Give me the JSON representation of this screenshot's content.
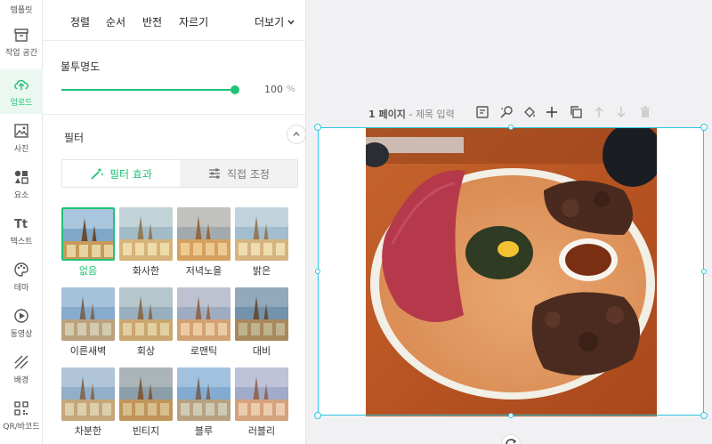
{
  "rail": {
    "template_label": "템플릿",
    "items": [
      {
        "label": "작업 공간",
        "icon": "archive-icon"
      },
      {
        "label": "업로드",
        "icon": "cloud-upload-icon",
        "active": true
      },
      {
        "label": "사진",
        "icon": "image-icon"
      },
      {
        "label": "요소",
        "icon": "shapes-icon"
      },
      {
        "label": "텍스트",
        "icon": "text-icon"
      },
      {
        "label": "테마",
        "icon": "palette-icon"
      },
      {
        "label": "동영상",
        "icon": "play-icon"
      },
      {
        "label": "배경",
        "icon": "stripes-icon"
      },
      {
        "label": "QR/바코드",
        "icon": "qr-icon"
      }
    ]
  },
  "toolbar": {
    "align": "정렬",
    "order": "순서",
    "flip": "반전",
    "crop": "자르기",
    "more": "더보기"
  },
  "opacity": {
    "label": "불투명도",
    "value": "100",
    "unit": "%",
    "level": 1.0
  },
  "filters": {
    "label": "필터",
    "tabs": {
      "effects": "필터 효과",
      "manual": "직접 조정"
    },
    "presets": [
      "없음",
      "화사한",
      "저녁노을",
      "밝은",
      "이른새벽",
      "회상",
      "로맨틱",
      "대비",
      "차분한",
      "빈티지",
      "블루",
      "러블리"
    ],
    "selected": "없음"
  },
  "canvas": {
    "page_number": "1 페이지",
    "separator": " - ",
    "title_placeholder": "제목 입력"
  },
  "colors": {
    "accent": "#20c277",
    "selection": "#2ec5e0"
  }
}
